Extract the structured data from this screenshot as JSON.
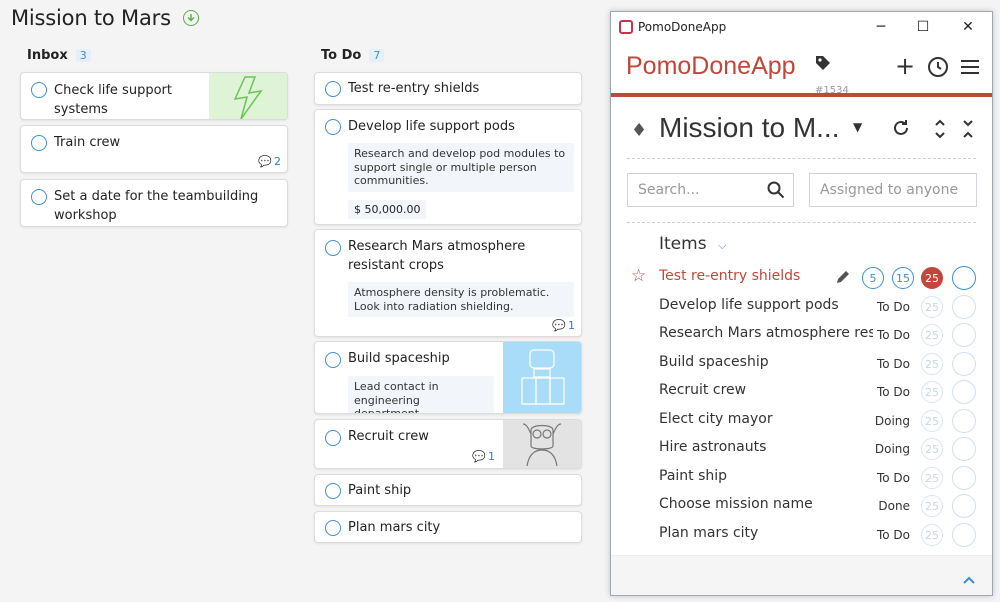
{
  "board": {
    "title": "Mission to Mars"
  },
  "inbox": {
    "name": "Inbox",
    "count": "3",
    "cards": [
      {
        "title": "Check life support systems"
      },
      {
        "title": "Train crew",
        "comments": "2"
      },
      {
        "title": "Set a date for the teambuilding workshop"
      }
    ]
  },
  "todo": {
    "name": "To Do",
    "count": "7",
    "cards": [
      {
        "title": "Test re-entry shields"
      },
      {
        "title": "Develop life support pods",
        "note": "Research and develop pod modules to support single or multiple person communities.",
        "price": "$ 50,000.00"
      },
      {
        "title": "Research Mars atmosphere resistant crops",
        "note": "Atmosphere density is problematic. Look into radiation shielding.",
        "comments": "1"
      },
      {
        "title": "Build spaceship",
        "note": "Lead contact in engineering department"
      },
      {
        "title": "Recruit crew",
        "comments": "1"
      },
      {
        "title": "Paint ship"
      },
      {
        "title": "Plan mars city"
      }
    ]
  },
  "window": {
    "title": "PomoDoneApp",
    "app_title": "PomoDoneApp",
    "id": "#1534",
    "project": "Mission to M...",
    "search_placeholder": "Search...",
    "assigned_placeholder": "Assigned to anyone",
    "items_label": "Items",
    "pomo_values": [
      "5",
      "15",
      "25"
    ],
    "items": [
      {
        "name": "Test re-entry shields",
        "status": "",
        "active": true
      },
      {
        "name": "Develop life support pods",
        "status": "To Do",
        "pomo": "25"
      },
      {
        "name": "Research Mars atmosphere resistant crops",
        "status": "To Do",
        "pomo": "25"
      },
      {
        "name": "Build spaceship",
        "status": "To Do",
        "pomo": "25"
      },
      {
        "name": "Recruit crew",
        "status": "To Do",
        "pomo": "25"
      },
      {
        "name": "Elect city mayor",
        "status": "Doing",
        "pomo": "25"
      },
      {
        "name": "Hire astronauts",
        "status": "Doing",
        "pomo": "25"
      },
      {
        "name": "Paint ship",
        "status": "To Do",
        "pomo": "25"
      },
      {
        "name": "Choose mission name",
        "status": "Done",
        "pomo": "25"
      },
      {
        "name": "Plan mars city",
        "status": "To Do",
        "pomo": "25"
      }
    ]
  },
  "colors": {
    "accent": "#c0473a",
    "blue": "#3b8fd6",
    "green": "#5aae45"
  }
}
